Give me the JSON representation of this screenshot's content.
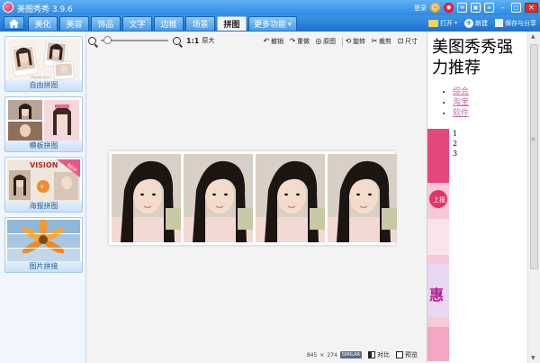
{
  "window": {
    "title": "美图秀秀 3.9.6",
    "user": "登录"
  },
  "nav": {
    "tabs": [
      {
        "label": "美化"
      },
      {
        "label": "美容"
      },
      {
        "label": "饰品"
      },
      {
        "label": "文字"
      },
      {
        "label": "边框"
      },
      {
        "label": "场景"
      },
      {
        "label": "拼图"
      },
      {
        "label": "更多功能"
      }
    ],
    "active_tab": "拼图",
    "actions": {
      "open": "打开",
      "new": "新建",
      "save_share": "保存与分享"
    }
  },
  "left_panel": {
    "items": [
      {
        "label": "自由拼图"
      },
      {
        "label": "模板拼图"
      },
      {
        "label": "海报拼图"
      },
      {
        "label": "图片拼接"
      }
    ],
    "poster_thumb_text": "VISION",
    "poster_ribbon": "NEW"
  },
  "toolbar": {
    "zoom_ratio": "1:1",
    "original_size": "原大",
    "zoom_level": 0.04,
    "tools": {
      "undo": "撤销",
      "redo": "重做",
      "original": "原图",
      "rotate": "旋转",
      "crop": "裁剪",
      "size": "尺寸"
    }
  },
  "status": {
    "width": "845",
    "times": "×",
    "height": "274",
    "format_badge": "SIMILAR",
    "compare": "对比",
    "preview": "预览"
  },
  "right_panel": {
    "heading": "美图秀秀强力推荐",
    "links": [
      "综合",
      "淘宝",
      "软件"
    ],
    "numbers": [
      "1",
      "2",
      "3"
    ],
    "ad_text": "上报"
  },
  "colors": {
    "titlebar": "#3a95e6",
    "active_tab": "#f4f4f4",
    "link": "#c46fa7",
    "canvas_bg": "#f3f3f3"
  }
}
